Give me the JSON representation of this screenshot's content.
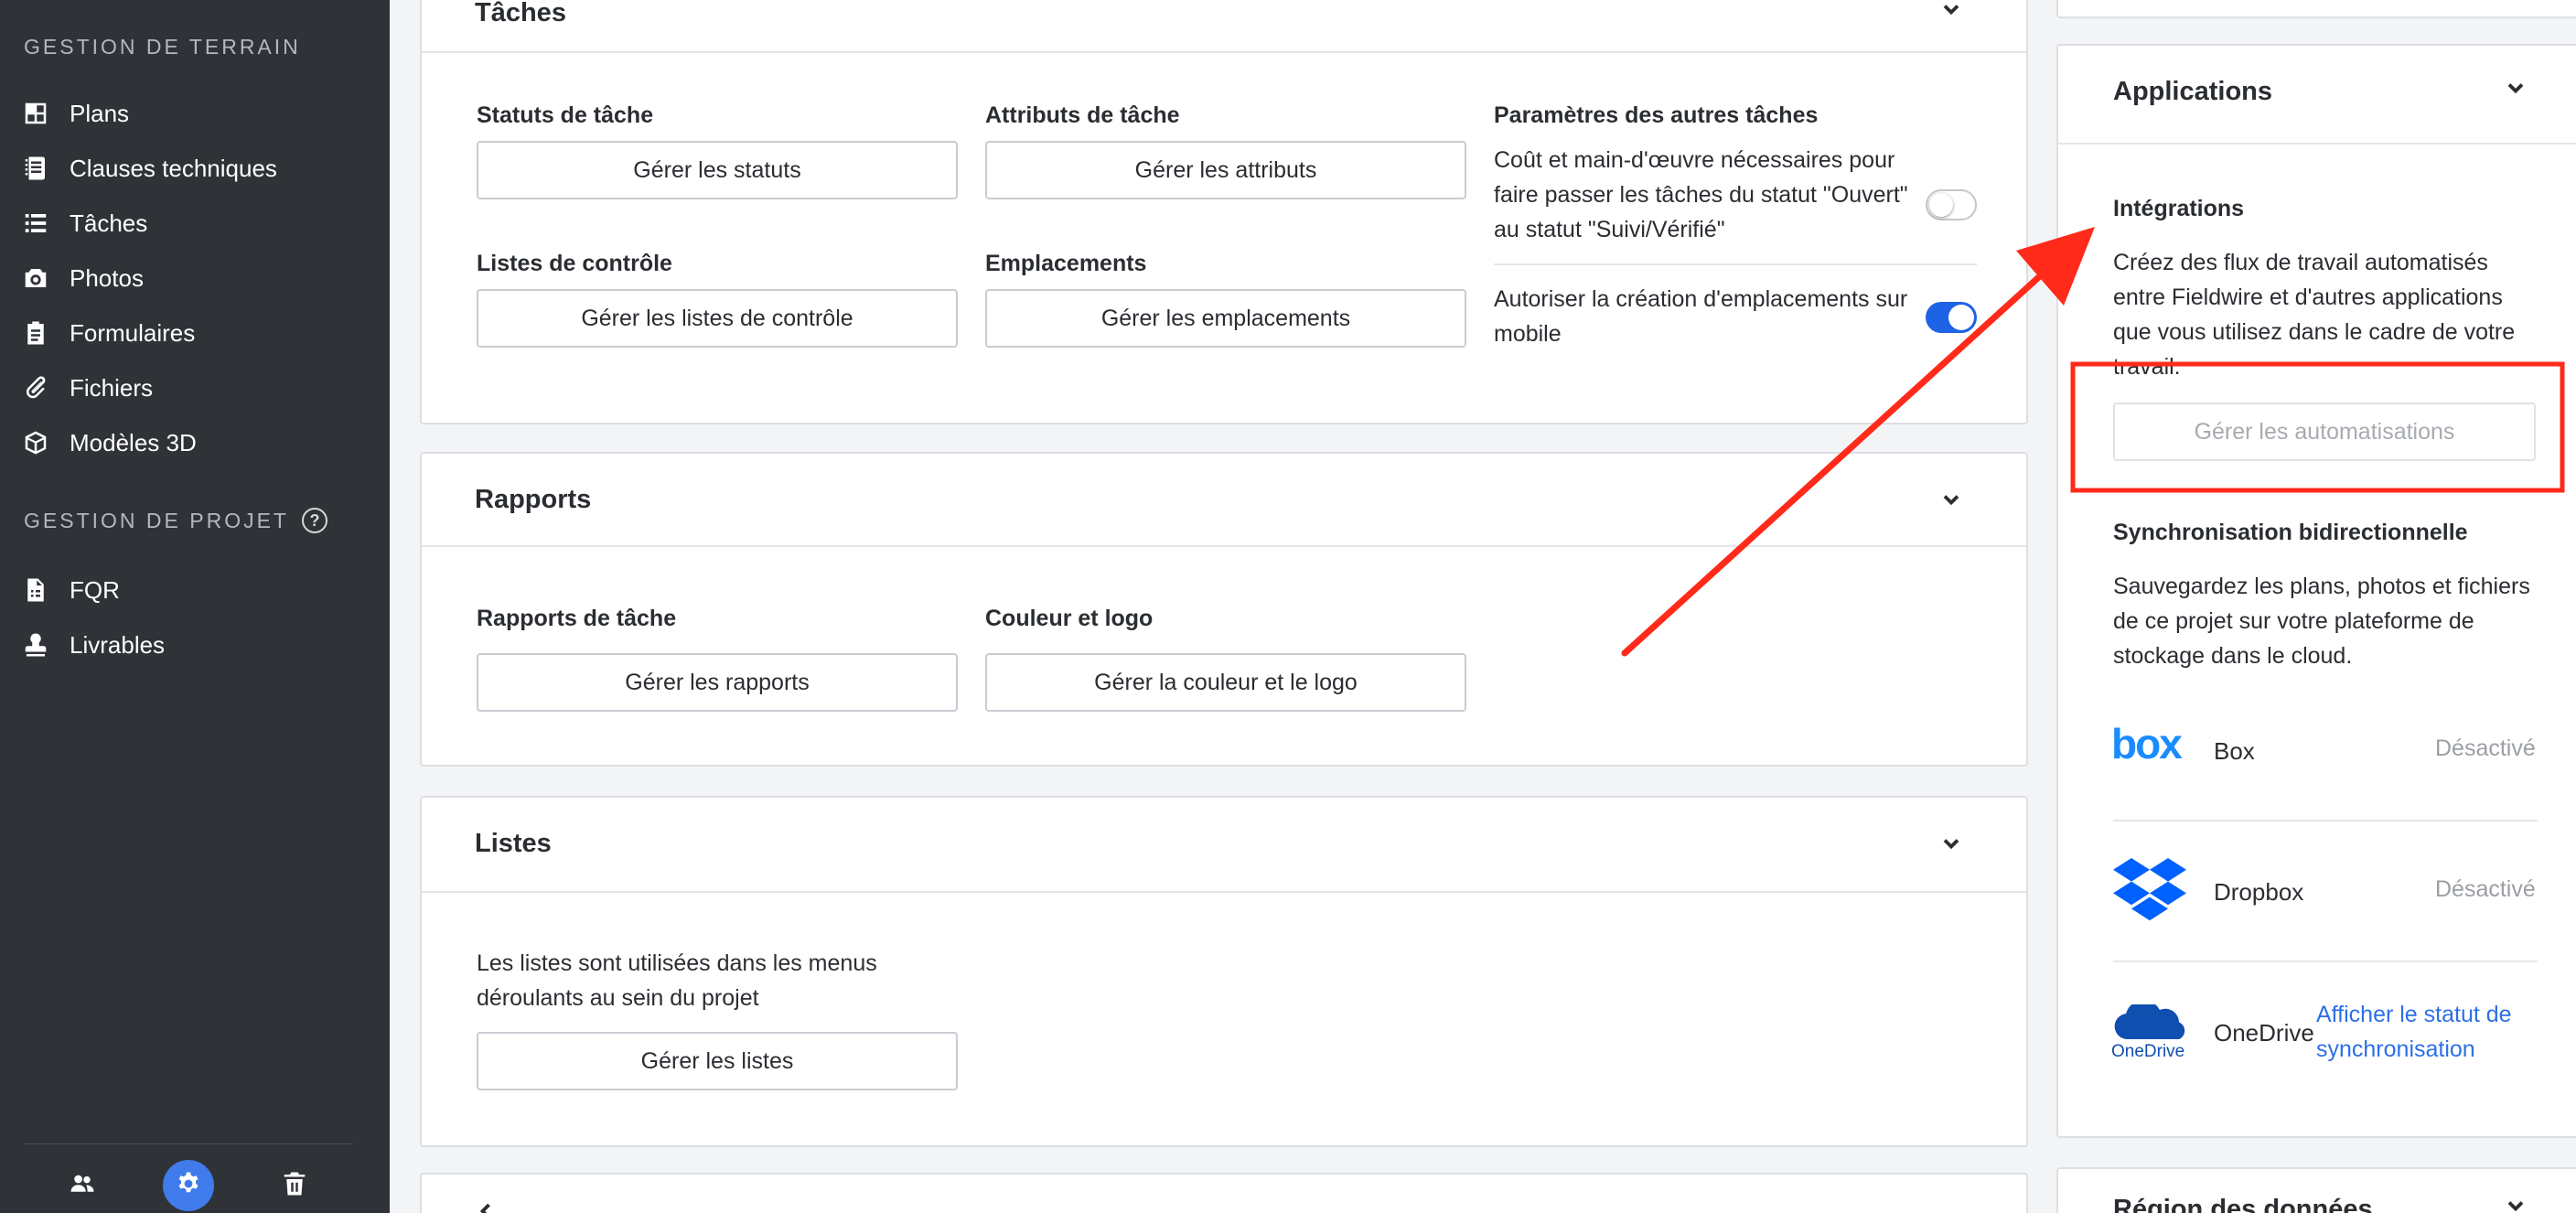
{
  "sidebar": {
    "section1": "GESTION DE TERRAIN",
    "section2": "GESTION DE PROJET",
    "help_glyph": "?",
    "items1": [
      {
        "label": "Plans",
        "icon": "plans-icon"
      },
      {
        "label": "Clauses techniques",
        "icon": "specifications-icon"
      },
      {
        "label": "Tâches",
        "icon": "tasks-icon"
      },
      {
        "label": "Photos",
        "icon": "camera-icon"
      },
      {
        "label": "Formulaires",
        "icon": "forms-icon"
      },
      {
        "label": "Fichiers",
        "icon": "paperclip-icon"
      },
      {
        "label": "Modèles 3D",
        "icon": "cube-icon"
      }
    ],
    "items2": [
      {
        "label": "FQR",
        "icon": "document-icon"
      },
      {
        "label": "Livrables",
        "icon": "stamp-icon"
      }
    ],
    "bottom": [
      "people-icon",
      "gear-icon",
      "trash-icon"
    ]
  },
  "taches": {
    "title": "Tâches",
    "statuts_label": "Statuts de tâche",
    "statuts_btn": "Gérer les statuts",
    "attributs_label": "Attributs de tâche",
    "attributs_btn": "Gérer les attributs",
    "listes_label": "Listes de contrôle",
    "listes_btn": "Gérer les listes de contrôle",
    "emplacements_label": "Emplacements",
    "emplacements_btn": "Gérer les emplacements",
    "params_label": "Paramètres des autres tâches",
    "param1_line1": "Coût et main-d'œuvre nécessaires pour",
    "param1_line2": "faire passer les tâches du statut \"Ouvert\"",
    "param1_line3": "au statut \"Suivi/Vérifié\"",
    "param1_enabled": false,
    "param2_line1": "Autoriser la création d'emplacements sur",
    "param2_line2": "mobile",
    "param2_enabled": true
  },
  "rapports": {
    "title": "Rapports",
    "rapports_label": "Rapports de tâche",
    "rapports_btn": "Gérer les rapports",
    "couleur_label": "Couleur et logo",
    "couleur_btn": "Gérer la couleur et le logo"
  },
  "listes": {
    "title": "Listes",
    "desc_line1": "Les listes sont utilisées dans les menus",
    "desc_line2": "déroulants au sein du projet",
    "btn": "Gérer les listes"
  },
  "applications": {
    "title": "Applications",
    "integrations_label": "Intégrations",
    "integrations_line1": "Créez des flux de travail automatisés",
    "integrations_line2": "entre Fieldwire et d'autres applications",
    "integrations_line3": "que vous utilisez dans le cadre de votre",
    "integrations_line4": "travail.",
    "automations_btn": "Gérer les automatisations",
    "sync_label": "Synchronisation bidirectionnelle",
    "sync_line1": "Sauvegardez les plans, photos et fichiers",
    "sync_line2": "de ce projet sur votre plateforme de",
    "sync_line3": "stockage dans le cloud.",
    "box_logo": "box",
    "box_name": "Box",
    "box_status": "Désactivé",
    "dropbox_name": "Dropbox",
    "dropbox_status": "Désactivé",
    "onedrive_logo": "OneDrive",
    "onedrive_name": "OneDrive",
    "onedrive_link_line1": "Afficher le statut de",
    "onedrive_link_line2": "synchronisation"
  },
  "region": {
    "title": "Région des données"
  },
  "annotation": {
    "color": "#ff2a1a"
  }
}
